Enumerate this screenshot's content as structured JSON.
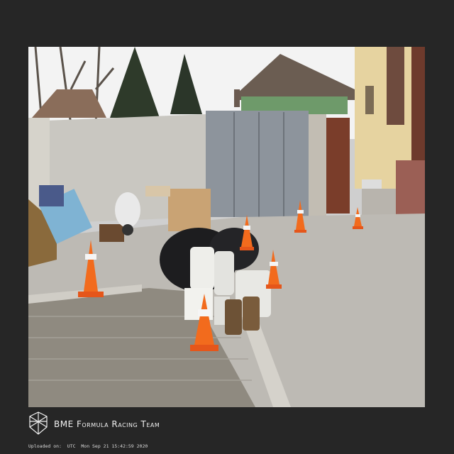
{
  "photo": {
    "scene": "courtyard-with-traffic-cones",
    "colors": {
      "sky": "#f2f2f2",
      "wall": "#c9c7c1",
      "gate": "#8d949c",
      "pavement": "#bcbab5",
      "cone": "#f26b1d",
      "house": "#e6d3a0",
      "roof": "#6b5d52",
      "door": "#7a3d2a"
    }
  },
  "brand": {
    "name": "BME Formula Racing Team",
    "logo_icon": "cube-logo-icon"
  },
  "footer": {
    "upload_label": "Uploaded on:",
    "upload_timestamp": "UTC  Mon Sep 21 15:42:59 2020"
  }
}
